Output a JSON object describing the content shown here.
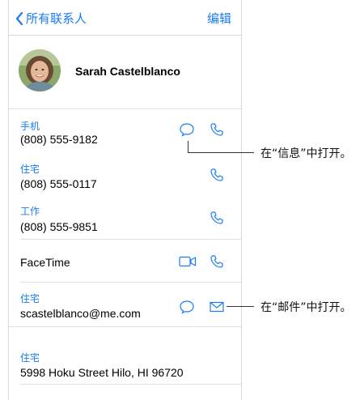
{
  "nav": {
    "back_label": "所有联系人",
    "edit_label": "编辑"
  },
  "contact": {
    "name": "Sarah Castelblanco"
  },
  "phones": [
    {
      "label": "手机",
      "number": "(808) 555-9182"
    },
    {
      "label": "住宅",
      "number": "(808) 555-0117"
    },
    {
      "label": "工作",
      "number": "(808) 555-9851"
    }
  ],
  "facetime": {
    "label": "FaceTime"
  },
  "email": {
    "label": "住宅",
    "address": "scastelblanco@me.com"
  },
  "address": {
    "label": "住宅",
    "text": "5998 Hoku Street Hilo, HI 96720"
  },
  "callouts": {
    "messages": "在“信息”中打开。",
    "mail": "在“邮件”中打开。"
  },
  "colors": {
    "accent": "#1a7cf5"
  }
}
